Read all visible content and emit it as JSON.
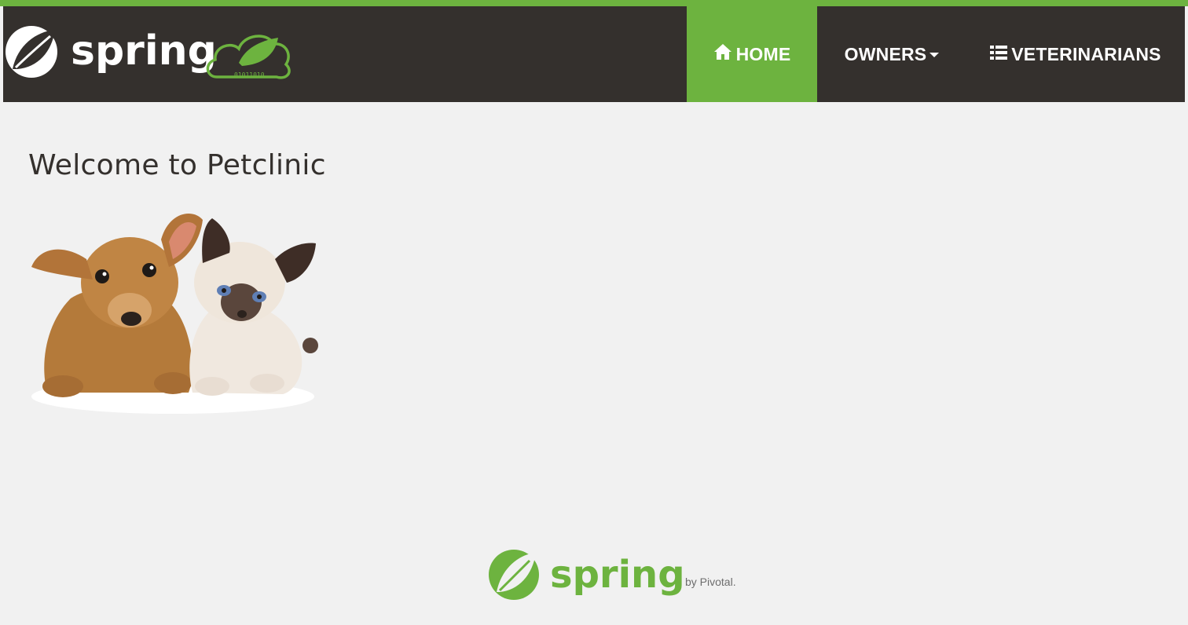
{
  "header": {
    "logo_text": "spring",
    "logo_binary": "01011010"
  },
  "nav": {
    "home_label": "HOME",
    "owners_label": "OWNERS",
    "vets_label": "VETERINARIANS",
    "home_icon": "home-icon",
    "owners_icon": "caret-down-icon",
    "vets_icon": "list-icon"
  },
  "main": {
    "title": "Welcome to Petclinic",
    "image": "pets-image"
  },
  "footer": {
    "logo_text": "spring",
    "by_text": "by Pivotal."
  },
  "colors": {
    "accent": "#6db33f",
    "navbar": "#34302d",
    "background": "#f1f1f1",
    "text": "#34302d"
  }
}
